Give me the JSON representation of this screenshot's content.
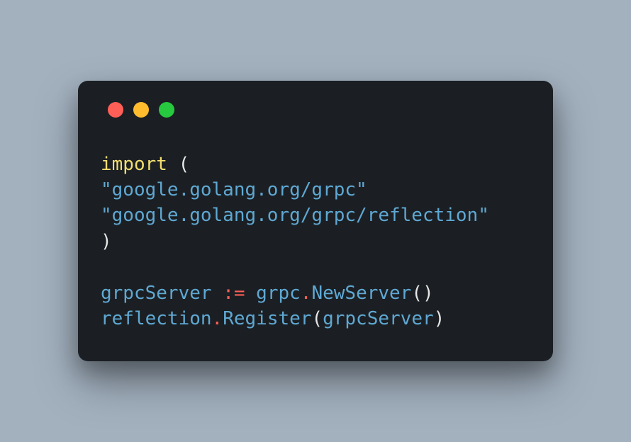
{
  "window": {
    "traffic_lights": [
      "red",
      "yellow",
      "green"
    ]
  },
  "code": {
    "lines": [
      {
        "tokens": [
          {
            "t": "import",
            "c": "kw"
          },
          {
            "t": " ",
            "c": "space"
          },
          {
            "t": "(",
            "c": "punct"
          }
        ]
      },
      {
        "tokens": [
          {
            "t": "\"google.golang.org/grpc\"",
            "c": "str"
          }
        ]
      },
      {
        "tokens": [
          {
            "t": "\"google.golang.org/grpc/reflection\"",
            "c": "str"
          }
        ]
      },
      {
        "tokens": [
          {
            "t": ")",
            "c": "punct"
          }
        ]
      },
      {
        "tokens": []
      },
      {
        "tokens": [
          {
            "t": "grpcServer",
            "c": "ident"
          },
          {
            "t": " ",
            "c": "space"
          },
          {
            "t": ":=",
            "c": "assign"
          },
          {
            "t": " ",
            "c": "space"
          },
          {
            "t": "grpc",
            "c": "pkg"
          },
          {
            "t": ".",
            "c": "dot-op"
          },
          {
            "t": "NewServer",
            "c": "fn"
          },
          {
            "t": "()",
            "c": "punct"
          }
        ]
      },
      {
        "tokens": [
          {
            "t": "reflection",
            "c": "pkg"
          },
          {
            "t": ".",
            "c": "dot-op"
          },
          {
            "t": "Register",
            "c": "fn"
          },
          {
            "t": "(",
            "c": "punct"
          },
          {
            "t": "grpcServer",
            "c": "ident"
          },
          {
            "t": ")",
            "c": "punct"
          }
        ]
      }
    ]
  }
}
